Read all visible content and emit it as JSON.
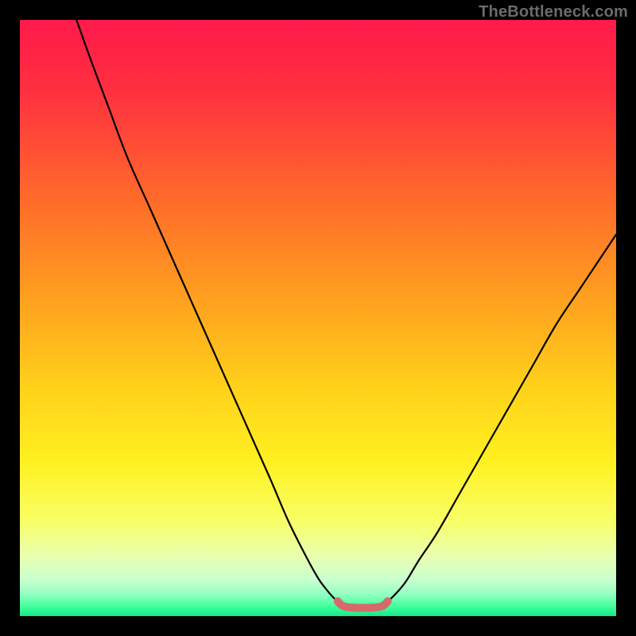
{
  "watermark": {
    "text": "TheBottleneck.com"
  },
  "chart_data": {
    "type": "line",
    "title": "",
    "xlabel": "",
    "ylabel": "",
    "xlim": [
      0,
      100
    ],
    "ylim": [
      0,
      100
    ],
    "gradient_stops": [
      {
        "offset": 0,
        "color": "#ff1a4b"
      },
      {
        "offset": 0.12,
        "color": "#ff3040"
      },
      {
        "offset": 0.3,
        "color": "#ff6a2a"
      },
      {
        "offset": 0.48,
        "color": "#ffa41f"
      },
      {
        "offset": 0.62,
        "color": "#ffd21a"
      },
      {
        "offset": 0.74,
        "color": "#fff020"
      },
      {
        "offset": 0.84,
        "color": "#f8ff66"
      },
      {
        "offset": 0.9,
        "color": "#e9ffb0"
      },
      {
        "offset": 0.94,
        "color": "#c8ffd0"
      },
      {
        "offset": 0.965,
        "color": "#8effc0"
      },
      {
        "offset": 0.985,
        "color": "#3cff9a"
      },
      {
        "offset": 1.0,
        "color": "#15e886"
      }
    ],
    "series": [
      {
        "name": "left-curve",
        "color": "#000000",
        "x": [
          9.5,
          12,
          15,
          18,
          22,
          26,
          30,
          34,
          38,
          42,
          45,
          48,
          50,
          51.3,
          52.5,
          53.3
        ],
        "y": [
          100,
          93,
          85,
          77,
          68,
          59,
          50,
          41,
          32,
          23,
          16,
          10,
          6.4,
          4.6,
          3.2,
          2.5
        ]
      },
      {
        "name": "right-curve",
        "color": "#000000",
        "x": [
          61.7,
          62.5,
          63.8,
          65,
          67,
          70,
          74,
          78,
          82,
          86,
          90,
          94,
          98,
          100
        ],
        "y": [
          2.5,
          3.2,
          4.6,
          6.2,
          9.5,
          14,
          21,
          28,
          35,
          42,
          49,
          55,
          61,
          64
        ]
      },
      {
        "name": "valley-floor",
        "color": "#d46a6a",
        "stroke_width": 10,
        "x": [
          53.3,
          54,
          55,
          56.5,
          58.5,
          60,
          61,
          61.7
        ],
        "y": [
          2.5,
          1.8,
          1.5,
          1.4,
          1.4,
          1.5,
          1.8,
          2.5
        ]
      }
    ],
    "annotations": []
  }
}
